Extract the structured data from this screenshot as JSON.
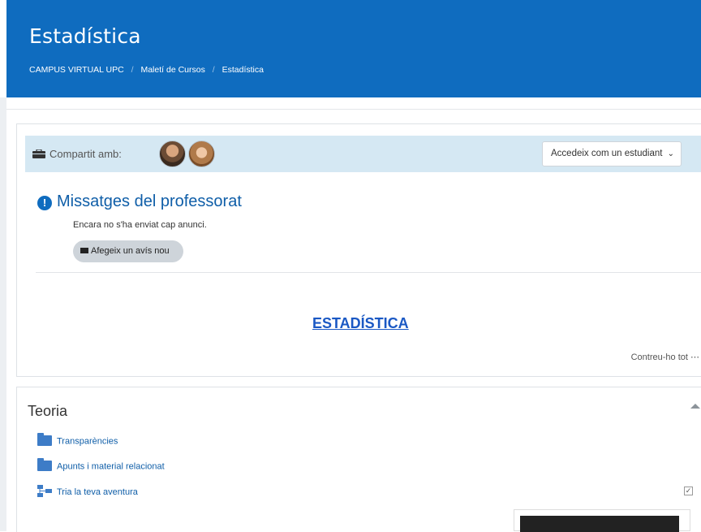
{
  "header": {
    "title": "Estadística",
    "breadcrumb": [
      "CAMPUS VIRTUAL UPC",
      "Maletí de Cursos",
      "Estadística"
    ]
  },
  "shared": {
    "label": "Compartit amb:",
    "icon": "briefcase-icon",
    "avatars": [
      "avatar-teacher-1",
      "avatar-teacher-2"
    ]
  },
  "role_select": {
    "value": "Accedeix com un estudiant"
  },
  "messages": {
    "title": "Missatges del professorat",
    "empty_text": "Encara no s'ha enviat cap anunci.",
    "add_button": "Afegeix un avís nou"
  },
  "course": {
    "link": "ESTADÍSTICA",
    "collapse_all": "Contreu-ho tot"
  },
  "section": {
    "title": "Teoria",
    "activities": [
      {
        "label": "Transparències",
        "icon": "folder-icon"
      },
      {
        "label": "Apunts i material relacionat",
        "icon": "folder-icon"
      },
      {
        "label": "Tria la teva aventura",
        "icon": "lesson-tree-icon"
      }
    ]
  },
  "colors": {
    "header_bg": "#0f6cbf",
    "shared_bar_bg": "#d5e8f3",
    "link": "#0f5ea8"
  }
}
